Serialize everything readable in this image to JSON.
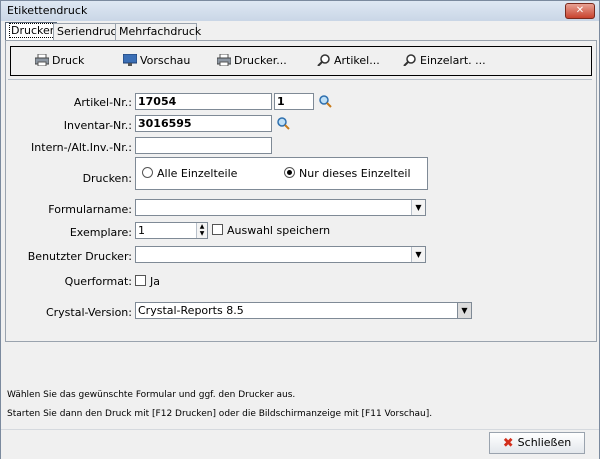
{
  "window": {
    "title": "Etikettendruck",
    "close_glyph": "✕"
  },
  "tabs": [
    {
      "label": "Drucken",
      "active": true
    },
    {
      "label": "Seriendruck",
      "active": false
    },
    {
      "label": "Mehrfachdruck",
      "active": false
    }
  ],
  "toolbar": {
    "druck": "Druck",
    "vorschau": "Vorschau",
    "drucker": "Drucker...",
    "artikel": "Artikel...",
    "einzelart": "Einzelart. ..."
  },
  "form": {
    "artikel_nr": {
      "label": "Artikel-Nr.:",
      "value": "17054",
      "suffix": "1"
    },
    "inventar_nr": {
      "label": "Inventar-Nr.:",
      "value": "3016595"
    },
    "intern_nr": {
      "label": "Intern-/Alt.Inv.-Nr.:",
      "value": ""
    },
    "drucken": {
      "label": "Drucken:",
      "option1": "Alle Einzelteile",
      "option2": "Nur dieses Einzelteil",
      "selected": "option2"
    },
    "formularname": {
      "label": "Formularname:",
      "value": ""
    },
    "exemplare": {
      "label": "Exemplare:",
      "value": "1",
      "save_label": "Auswahl speichern"
    },
    "benutzter_drucker": {
      "label": "Benutzter Drucker:",
      "value": ""
    },
    "querformat": {
      "label": "Querformat:",
      "checkbox_label": "Ja"
    },
    "crystal": {
      "label": "Crystal-Version:",
      "value": "Crystal-Reports 8.5"
    }
  },
  "info": {
    "line1": "Wählen Sie das gewünschte Formular und ggf. den Drucker aus.",
    "line2": "Starten Sie dann den Druck mit [F12 Drucken] oder die Bildschirmanzeige mit [F11 Vorschau]."
  },
  "footer": {
    "close_label": "Schließen"
  },
  "colors": {
    "accent": "#3b6fb6",
    "close_red": "#d32f1c"
  }
}
